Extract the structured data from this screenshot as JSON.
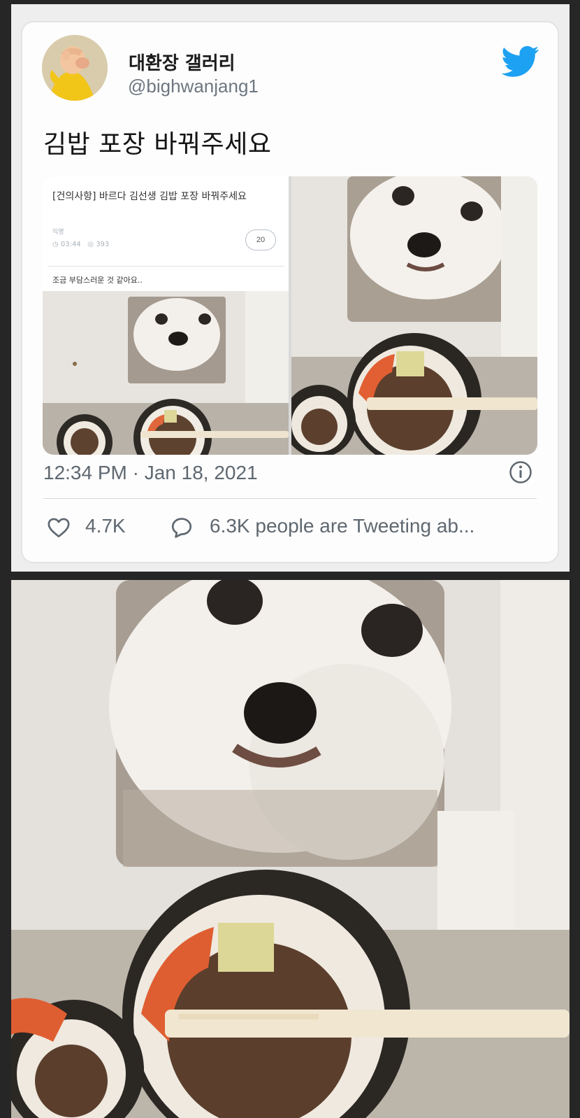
{
  "tweet": {
    "display_name": "대환장 갤러리",
    "handle": "@bighwanjang1",
    "text": "김밥 포장 바꿔주세요",
    "timestamp": "12:34 PM · Jan 18, 2021",
    "likes": "4.7K",
    "tweeting": "6.3K people are Tweeting ab..."
  },
  "embedded_post": {
    "title": "[건의사항] 바르다 김선생 김밥 포장 바꿔주세요",
    "author": "익명",
    "time": "03:44",
    "views": "393",
    "comments": "20",
    "body": "조금 부담스러운 것 같아요.."
  },
  "icons": {
    "bird": "twitter-bird-icon",
    "info": "info-icon",
    "like": "heart-icon",
    "reply": "speech-bubble-icon"
  },
  "colors": {
    "bird_blue": "#1da1f2",
    "meta_gray": "#5f6870",
    "page_bg": "#262626"
  }
}
